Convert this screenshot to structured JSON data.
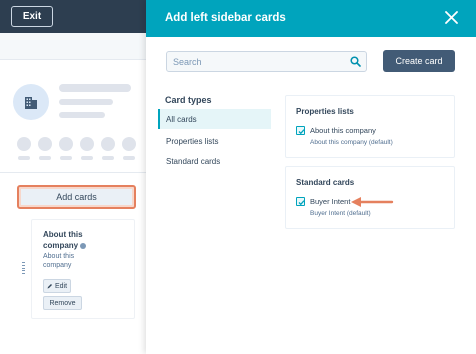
{
  "app": {
    "exit_label": "Exit",
    "add_cards_label": "Add cards",
    "card": {
      "title": "About this company",
      "description": "About this company",
      "edit_label": "Edit",
      "remove_label": "Remove"
    }
  },
  "panel": {
    "title": "Add left sidebar cards",
    "search_placeholder": "Search",
    "create_label": "Create card",
    "nav": {
      "heading": "Card types",
      "items": [
        {
          "label": "All cards",
          "active": true
        },
        {
          "label": "Properties lists",
          "active": false
        },
        {
          "label": "Standard cards",
          "active": false
        }
      ]
    },
    "sections": [
      {
        "title": "Properties lists",
        "option": {
          "label": "About this company",
          "sub": "About this company (default)",
          "checked": true
        }
      },
      {
        "title": "Standard cards",
        "option": {
          "label": "Buyer Intent",
          "sub": "Buyer Intent (default)",
          "checked": true
        }
      }
    ]
  },
  "colors": {
    "header": "#00a4bd",
    "highlight": "#e5805e",
    "dark": "#2d3e50"
  }
}
